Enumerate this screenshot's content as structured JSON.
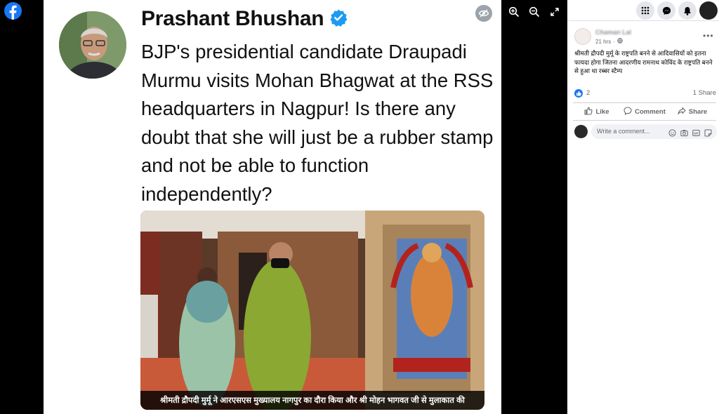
{
  "viewer": {
    "caption": "श्रीमती द्रौपदी मुर्मू ने आरएसएस मुख्यालय नागपुर का दौरा किया और श्री मोहन भागवत जी से मुलाकात की",
    "tweet": {
      "author_name": "Prashant Bhushan",
      "text": "BJP's presidential candidate Draupadi Murmu visits Mohan Bhagwat at the RSS headquarters in Nagpur! Is there any doubt that she will just be a rubber stamp and not be able to function independently?"
    },
    "tools": [
      "zoom-in-icon",
      "zoom-out-icon",
      "fullscreen-icon"
    ]
  },
  "sidebar": {
    "header_icons": [
      "menu-grid-icon",
      "messenger-icon",
      "notifications-icon",
      "account-avatar"
    ],
    "post": {
      "author": "Chaman Lal",
      "time": "21 hrs",
      "text": "श्रीमती द्रौपदी मुर्मू के राष्ट्रपति बनने से आदिवासियों को इतना फायदा होगा जितना आदरणीय रामनाथ कोविंद के राष्ट्रपति बनने से हुआ था रब्बर स्टैम्प",
      "reactions_count": "2",
      "shares": "1 Share"
    },
    "actions": {
      "like": "Like",
      "comment": "Comment",
      "share": "Share"
    },
    "comment_placeholder": "Write a comment..."
  },
  "colors": {
    "brand": "#1877f2",
    "verified": "#1d9bf0",
    "text": "#050505",
    "muted": "#65676b"
  }
}
